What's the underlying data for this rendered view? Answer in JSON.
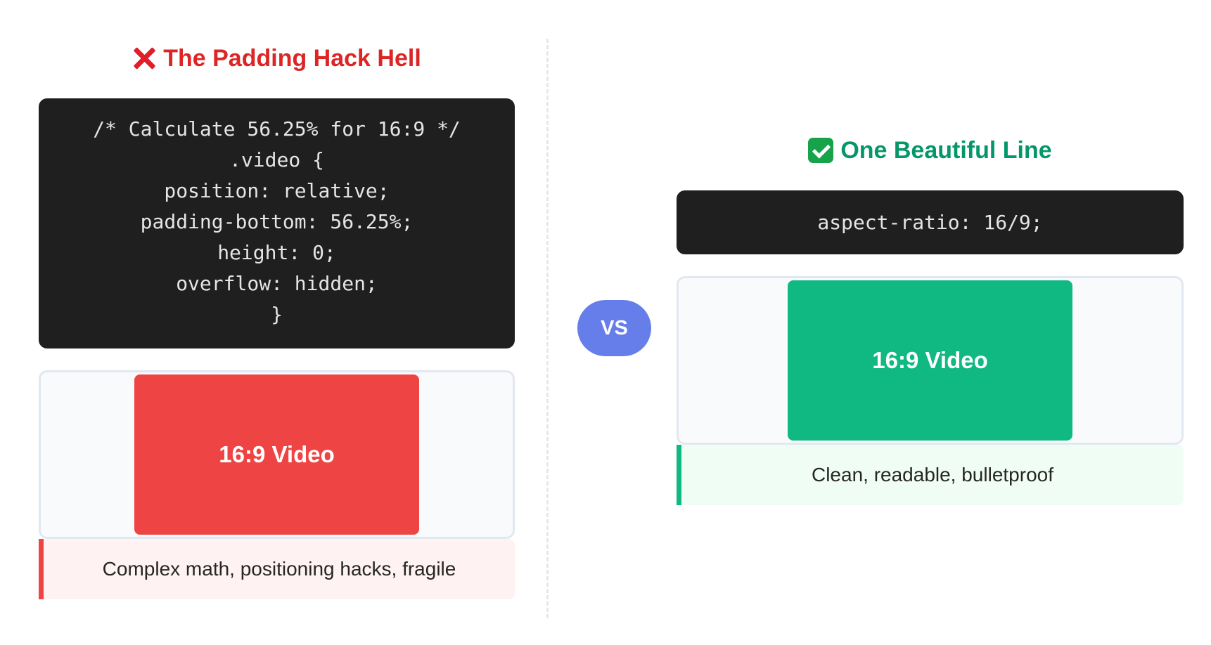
{
  "left": {
    "title": "The Padding Hack Hell",
    "icon": "cross-mark-icon",
    "accent": "#dc2626",
    "code_lines": [
      "/* Calculate 56.25% for 16:9 */",
      ".video {",
      "position: relative;",
      "padding-bottom: 56.25%;",
      "height: 0;",
      "overflow: hidden;",
      "}"
    ],
    "video_label": "16:9 Video",
    "video_color": "#ef4444",
    "caption": "Complex math, positioning hacks, fragile"
  },
  "vs_label": "VS",
  "right": {
    "title": "One Beautiful Line",
    "icon": "check-mark-icon",
    "accent": "#059669",
    "code_lines": [
      "aspect-ratio: 16/9;"
    ],
    "video_label": "16:9 Video",
    "video_color": "#10b981",
    "caption": "Clean, readable, bulletproof"
  }
}
